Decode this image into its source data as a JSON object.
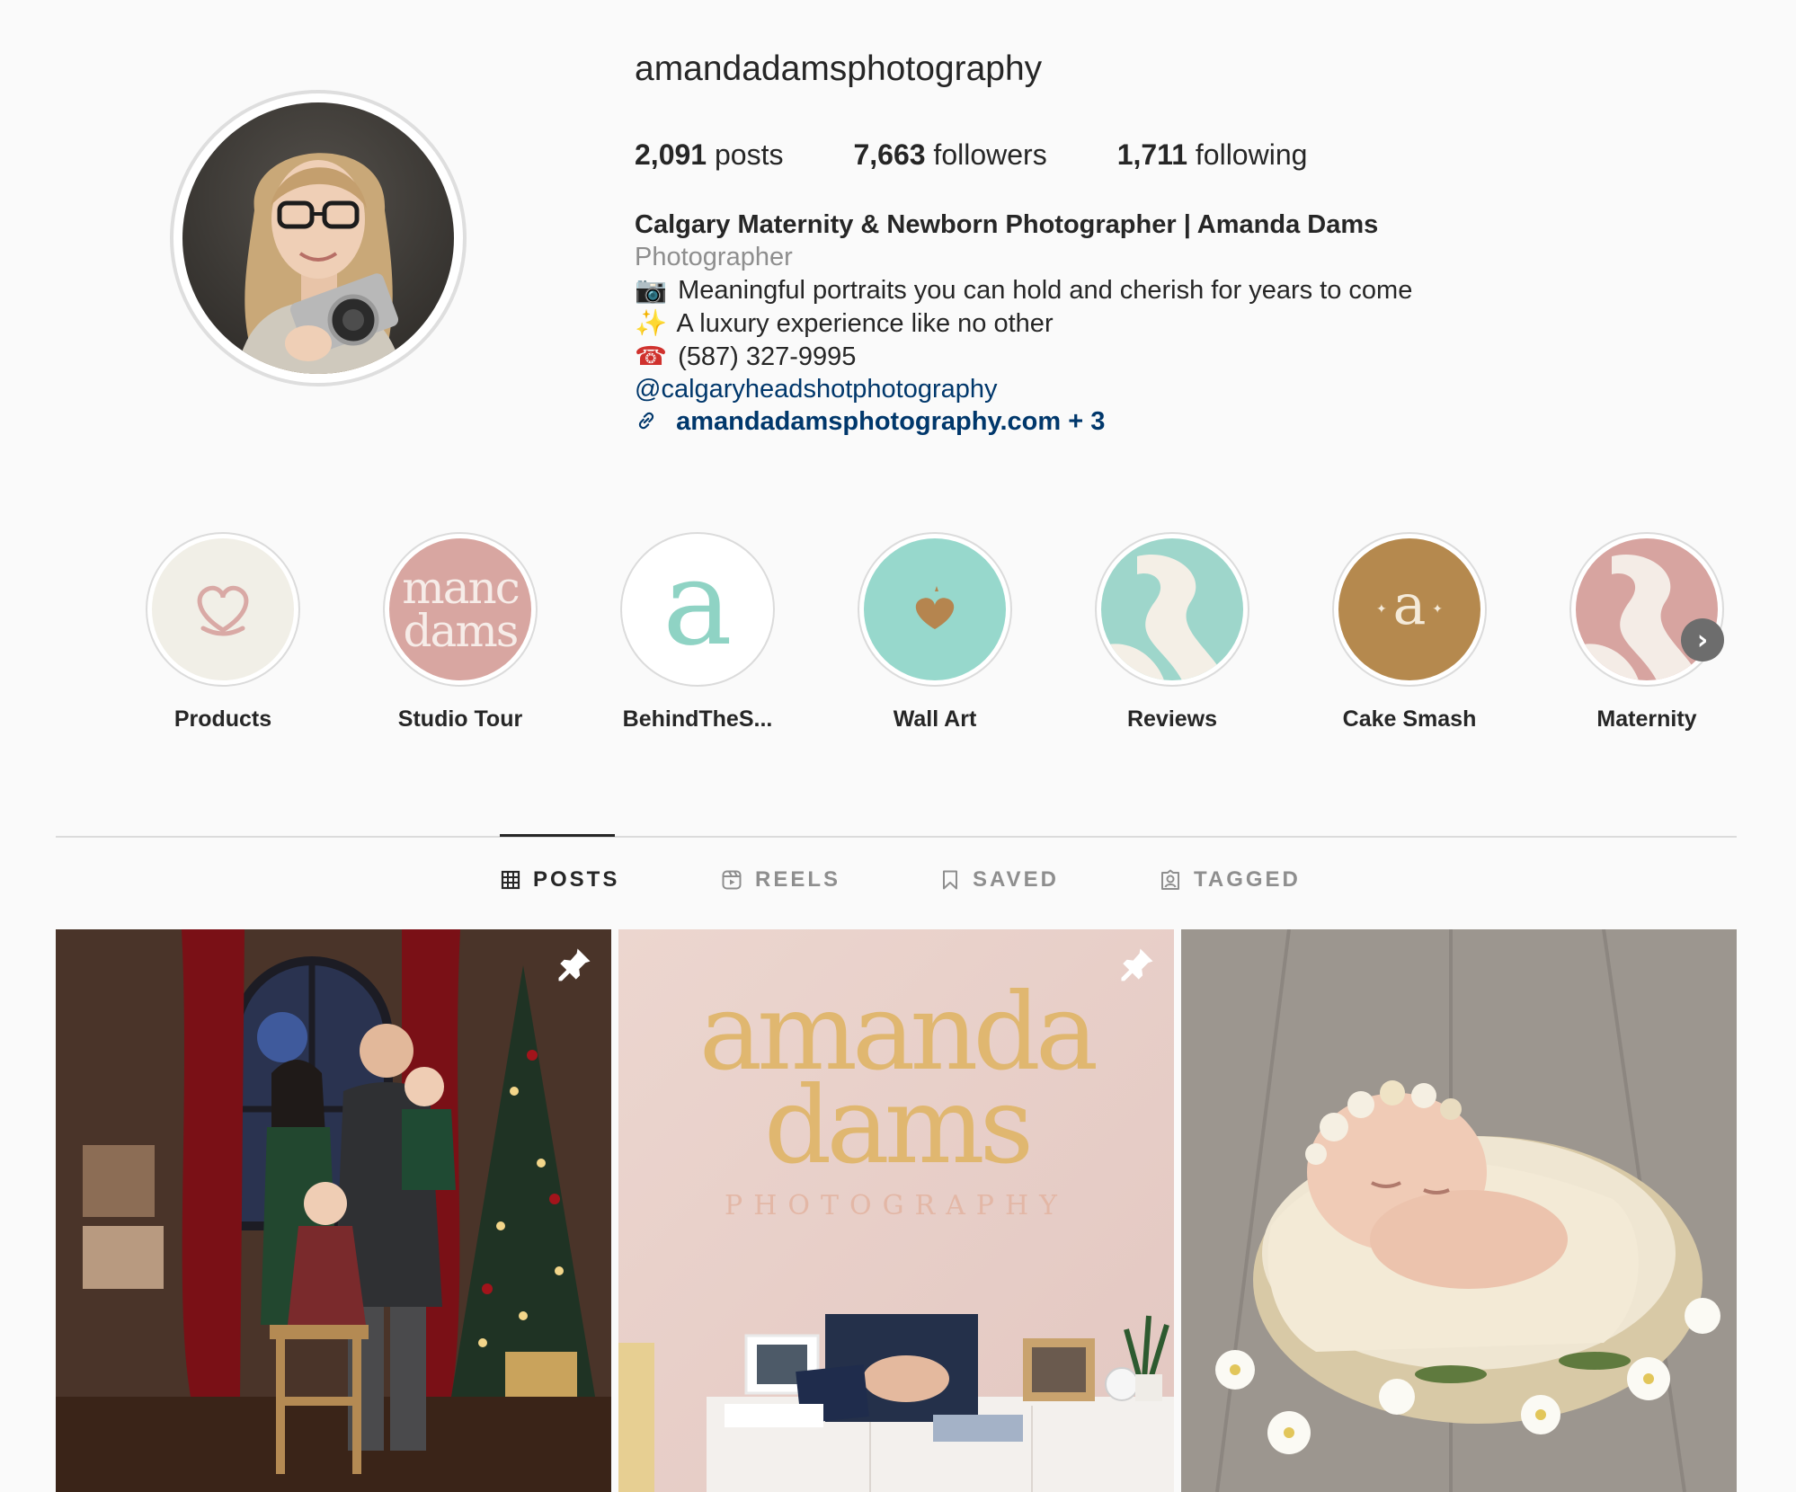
{
  "profile": {
    "username": "amandadamsphotography",
    "stats": {
      "posts_count": "2,091",
      "posts_label": "posts",
      "followers_count": "7,663",
      "followers_label": "followers",
      "following_count": "1,711",
      "following_label": "following"
    },
    "bio": {
      "name": "Calgary Maternity & Newborn Photographer | Amanda Dams",
      "category": "Photographer",
      "lines": [
        {
          "emoji": "📷",
          "text": "Meaningful portraits you can hold and cherish for years to come"
        },
        {
          "emoji": "✨",
          "text": "A luxury experience like no other"
        },
        {
          "emoji": "☎",
          "text": "(587) 327-9995"
        }
      ],
      "mention": "@calgaryheadshotphotography",
      "link": "amandadamsphotography.com + 3",
      "link_icon": "link-icon"
    }
  },
  "highlights": [
    {
      "label": "Products",
      "icon": "heart-outline-icon",
      "bg": "#f1efe7",
      "fg": "#d9a9a5"
    },
    {
      "label": "Studio Tour",
      "icon": "logo-text-icon",
      "bg": "#d8a6a1",
      "fg": "#f6ece8",
      "logo_lines": [
        "manc",
        "dams"
      ]
    },
    {
      "label": "BehindTheS...",
      "icon": "letter-a-icon",
      "bg": "#ffffff",
      "fg": "#8fd3c4",
      "letter": "a"
    },
    {
      "label": "Wall Art",
      "icon": "heart-filled-icon",
      "bg": "#97d8cc",
      "fg": "#b5854f"
    },
    {
      "label": "Reviews",
      "icon": "logo-swirl-icon",
      "bg": "#9ed6cb",
      "fg": "#f4efe6"
    },
    {
      "label": "Cake Smash",
      "icon": "letter-a-icon",
      "bg": "#b5894e",
      "fg": "#f4ead9",
      "letter": "a"
    },
    {
      "label": "Maternity",
      "icon": "logo-swirl-icon",
      "bg": "#d7a4a0",
      "fg": "#f4ece6"
    }
  ],
  "highlights_next_icon": "chevron-right-icon",
  "tabs": [
    {
      "label": "POSTS",
      "icon": "grid-icon",
      "active": true
    },
    {
      "label": "REELS",
      "icon": "reels-icon",
      "active": false
    },
    {
      "label": "SAVED",
      "icon": "bookmark-icon",
      "active": false
    },
    {
      "label": "TAGGED",
      "icon": "tagged-icon",
      "active": false
    }
  ],
  "posts": [
    {
      "subject": "family-christmas-portrait",
      "pinned": true
    },
    {
      "subject": "studio-logo-wall",
      "pinned": true,
      "logo_lines": [
        "amanda",
        "dams"
      ],
      "logo_sub": "PHOTOGRAPHY"
    },
    {
      "subject": "newborn-in-basket",
      "pinned": false
    }
  ],
  "colors": {
    "background": "#fafafa",
    "text": "#262626",
    "muted": "#8e8e8e",
    "link": "#00376b",
    "border": "#dbdbdb"
  }
}
